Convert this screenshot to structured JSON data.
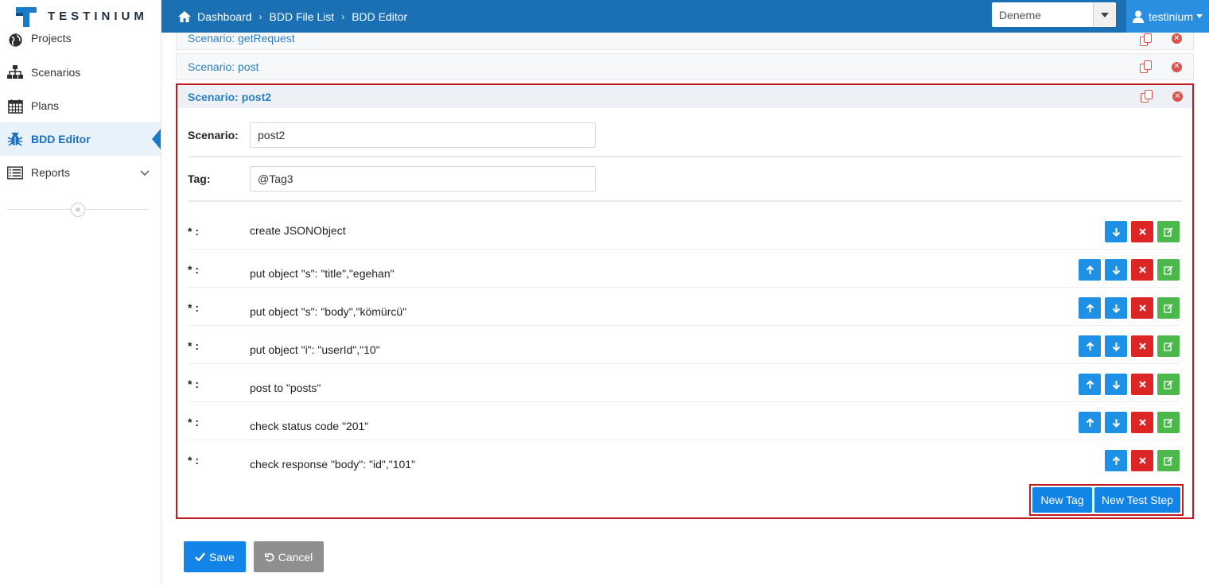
{
  "brand": {
    "name": "TESTINIUM",
    "accent": "#1b6fb3"
  },
  "topbar": {
    "breadcrumbs": [
      "Dashboard",
      "BDD File List",
      "BDD Editor"
    ],
    "project_select": "Deneme",
    "user": "testinium"
  },
  "sidebar": {
    "items": [
      {
        "label": "Projects",
        "icon": "globe-icon"
      },
      {
        "label": "Scenarios",
        "icon": "sitemap-icon"
      },
      {
        "label": "Plans",
        "icon": "calendar-icon"
      },
      {
        "label": "BDD Editor",
        "icon": "bug-icon",
        "active": true
      },
      {
        "label": "Reports",
        "icon": "list-icon",
        "expandable": true
      }
    ]
  },
  "scenarios": {
    "collapsed": [
      "Scenario: getRequest",
      "Scenario: post"
    ],
    "open": {
      "title": "Scenario: post2",
      "scenario_label": "Scenario:",
      "scenario_value": "post2",
      "tag_label": "Tag:",
      "tag_value": "@Tag3",
      "step_marker": "* :",
      "steps": [
        "create JSONObject",
        "put object \"s\": \"title\",\"egehan\"",
        "put object \"s\": \"body\",\"kömürcü\"",
        "put object \"i\": \"userId\",\"10\"",
        "post to \"posts\"",
        "check status code \"201\"",
        "check response \"body\": \"id\",\"101\""
      ],
      "new_tag_label": "New Tag",
      "new_step_label": "New Test Step"
    }
  },
  "actions": {
    "save": "Save",
    "cancel": "Cancel"
  }
}
